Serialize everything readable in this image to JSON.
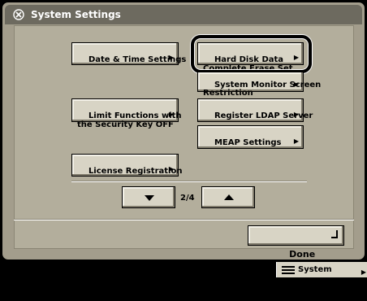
{
  "window": {
    "title": "System Settings"
  },
  "settings_buttons": {
    "date_time": "Date & Time Settings",
    "hard_disk_erase": "Hard Disk Data\nComplete Erase Set.",
    "system_monitor_restriction": "System Monitor Screen\nRestriction",
    "limit_functions": "Limit Functions with\nthe Security Key OFF",
    "register_ldap": "Register LDAP Server",
    "meap": "MEAP Settings",
    "license": "License Registration"
  },
  "pagination": {
    "indicator": "2/4"
  },
  "footer": {
    "done_label": "Done"
  },
  "status_bar": {
    "system_monitor_label": "System Monitor"
  },
  "icons": {
    "title": "settings-icon",
    "submenu_arrow": "triangle-right-icon",
    "prev": "triangle-down-icon",
    "next": "triangle-up-icon",
    "done": "return-icon",
    "system_monitor": "monitor-icon"
  }
}
